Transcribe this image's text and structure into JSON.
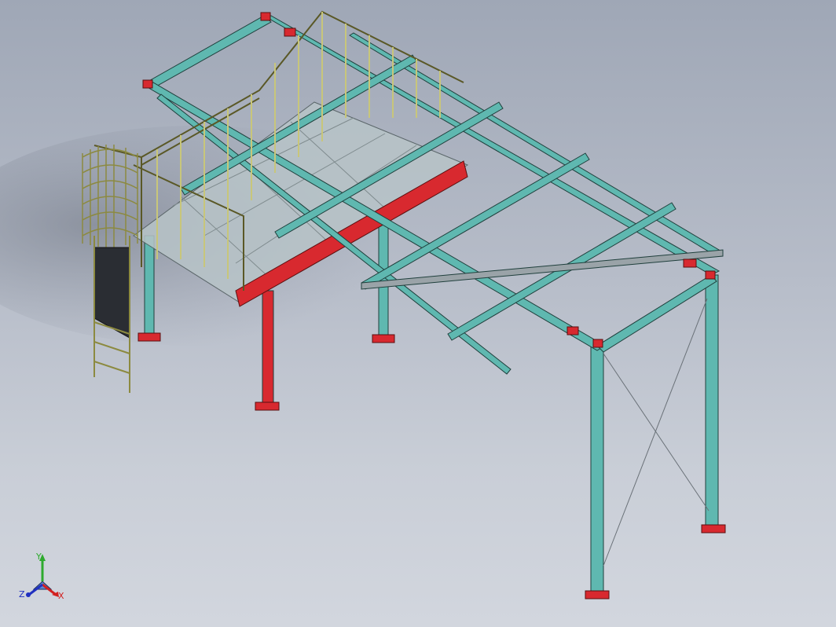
{
  "viewport": {
    "background_top": "#9fa7b6",
    "background_bottom": "#d2d6de"
  },
  "colors": {
    "beam": "#5fb8b0",
    "beam_edge": "#1f3f3c",
    "handrail": "#d8d68a",
    "handrail_edge": "#5a5826",
    "red_beam": "#d8292f",
    "base_plate": "#d8292f",
    "ladder_cage": "#d8d68a",
    "grating": "#b8c4c8"
  },
  "triad": {
    "y_label": "Y",
    "x_label": "X",
    "z_label": "Z",
    "y_color": "#2eaa2e",
    "x_color": "#d22020",
    "z_color": "#2030c0"
  }
}
